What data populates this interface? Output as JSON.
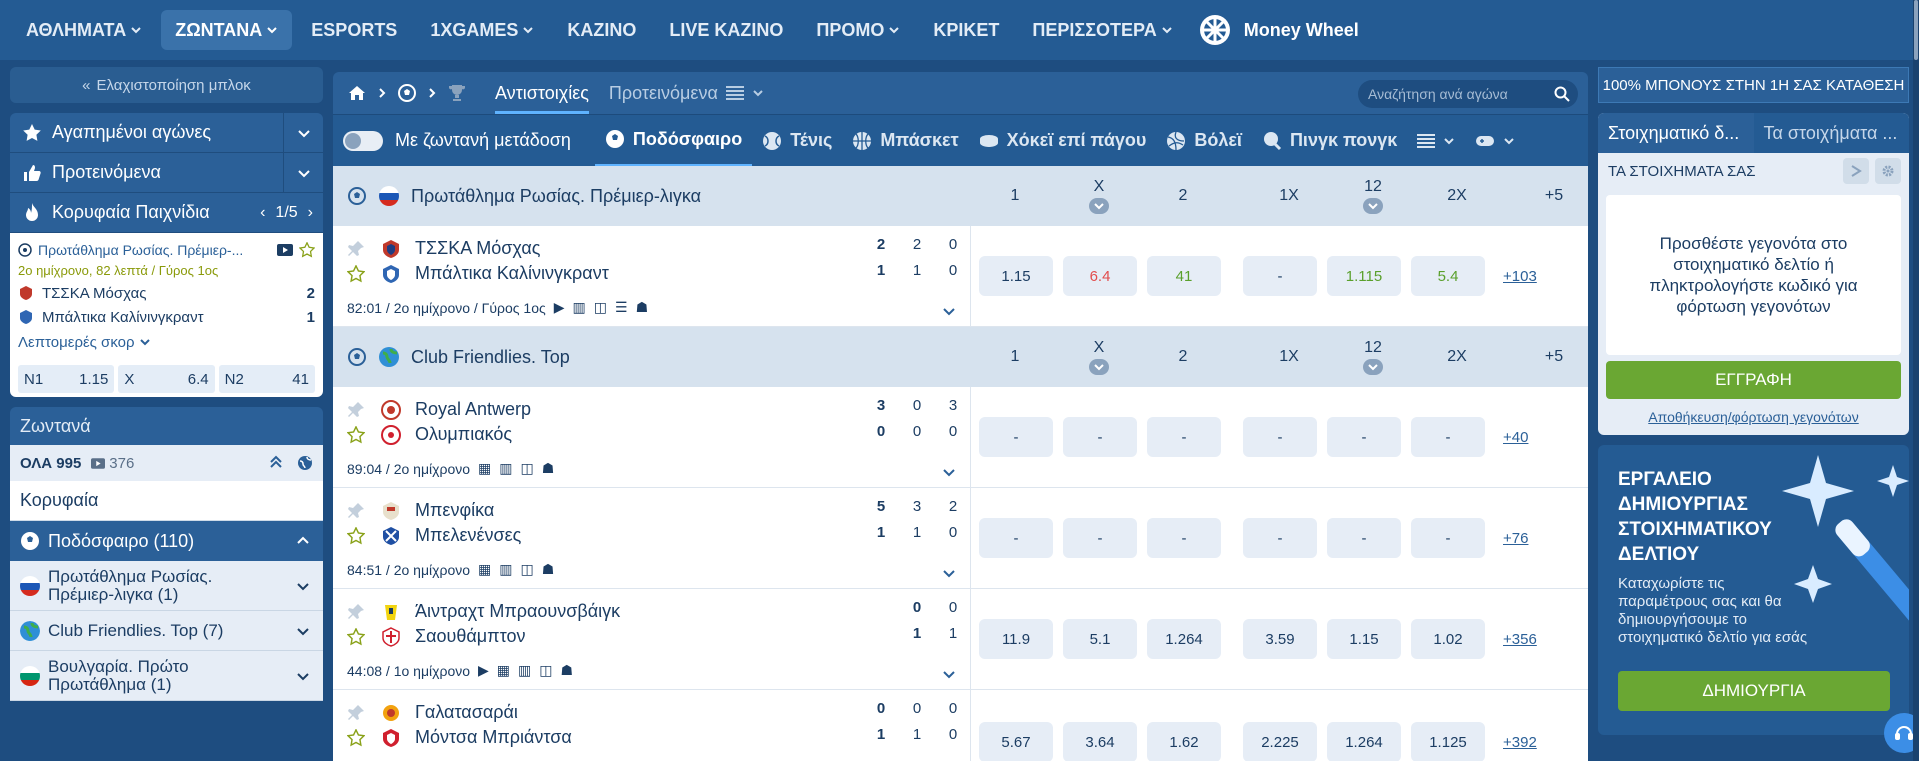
{
  "colors": {
    "nav_bg": "#245b93",
    "page_bg": "#1e4d80",
    "accent_green": "#6aa733",
    "odd_up": "#5aa02c",
    "odd_down": "#e24c4c",
    "link_blue": "#2b6098"
  },
  "nav": {
    "items": [
      {
        "label": "ΑΘΛΗΜΑΤΑ",
        "dropdown": true
      },
      {
        "label": "ΖΩΝΤΑΝΑ",
        "dropdown": true,
        "active": true
      },
      {
        "label": "ESPORTS"
      },
      {
        "label": "1XGAMES",
        "dropdown": true
      },
      {
        "label": "ΚΑΖΙΝΟ"
      },
      {
        "label": "LIVE ΚΑΖΙΝΟ"
      },
      {
        "label": "ΠΡΟΜΟ",
        "dropdown": true
      },
      {
        "label": "ΚΡΙΚΕΤ"
      },
      {
        "label": "ΠΕΡΙΣΣΟΤΕΡΑ",
        "dropdown": true
      }
    ],
    "money_wheel": "Money Wheel"
  },
  "sidebar": {
    "collapse": "Ελαχιστοποίηση μπλοκ",
    "favorites": "Αγαπημένοι αγώνες",
    "recommended": "Προτεινόμενα",
    "top_games": "Κορυφαία Παιχνίδια",
    "pager": "1/5",
    "top_game": {
      "league": "Πρωτάθλημα Ρωσίας. Πρέμιερ-...",
      "status": "2ο ημίχρονο, 82 λεπτά / Γύρος 1ος",
      "team1": "ΤΣΣΚΑ Μόσχας",
      "score1": "2",
      "team2": "Μπάλτικα Καλίνινγκραντ",
      "score2": "1",
      "details": "Λεπτομερές σκορ",
      "odds": [
        {
          "label": "N1",
          "value": "1.15"
        },
        {
          "label": "X",
          "value": "6.4"
        },
        {
          "label": "N2",
          "value": "41"
        }
      ]
    },
    "live": "Ζωντανά",
    "all_label": "ΟΛΑ 995",
    "video_count": "376",
    "top": "Κορυφαία",
    "football": "Ποδόσφαιρο (110)",
    "leagues": [
      {
        "name": "Πρωτάθλημα Ρωσίας. Πρέμιερ-λιγκα (1)"
      },
      {
        "name": "Club Friendlies. Top (7)"
      },
      {
        "name": "Βουλγαρία. Πρώτο Πρωτάθλημα (1)"
      }
    ]
  },
  "main": {
    "tab_active": "Αντιστοιχίες",
    "tab_other": "Προτεινόμενα",
    "search_placeholder": "Αναζήτηση ανά αγώνα",
    "live_toggle": "Με ζωντανή μετάδοση",
    "sports": [
      "Ποδόσφαιρο",
      "Τένις",
      "Μπάσκετ",
      "Χόκεϊ επί πάγου",
      "Βόλεϊ",
      "Πινγκ πονγκ"
    ],
    "columns": [
      "1",
      "X",
      "2",
      "1X",
      "12",
      "2X",
      "+5"
    ],
    "leagues": [
      {
        "name": "Πρωτάθλημα Ρωσίας. Πρέμιερ-λιγκα",
        "matches": [
          {
            "team1": "ΤΣΣΚΑ Μόσχας",
            "team2": "Μπάλτικα Καλίνινγκραντ",
            "s1": [
              "2",
              "2",
              "0"
            ],
            "s2": [
              "1",
              "1",
              "0"
            ],
            "time": "82:01 / 2ο ημίχρονο / Γύρος 1ος",
            "odds": [
              "1.15",
              "6.4",
              "41",
              "-",
              "1.115",
              "5.4"
            ],
            "more": "+103"
          }
        ]
      },
      {
        "name": "Club Friendlies. Top",
        "matches": [
          {
            "team1": "Royal Antwerp",
            "team2": "Ολυμπιακός",
            "s1": [
              "3",
              "0",
              "3"
            ],
            "s2": [
              "0",
              "0",
              "0"
            ],
            "time": "89:04 / 2ο ημίχρονο",
            "odds": [
              "-",
              "-",
              "-",
              "-",
              "-",
              "-"
            ],
            "more": "+40"
          },
          {
            "team1": "Μπενφίκα",
            "team2": "Μπελενένσες",
            "s1": [
              "5",
              "3",
              "2"
            ],
            "s2": [
              "1",
              "1",
              "0"
            ],
            "time": "84:51 / 2ο ημίχρονο",
            "odds": [
              "-",
              "-",
              "-",
              "-",
              "-",
              "-"
            ],
            "more": "+76"
          },
          {
            "team1": "Άιντραχτ Μπραουνσβάιγκ",
            "team2": "Σαουθάμπτον",
            "s1": [
              "0",
              "0"
            ],
            "s2": [
              "1",
              "1"
            ],
            "time": "44:08 / 1ο ημίχρονο",
            "odds": [
              "11.9",
              "5.1",
              "1.264",
              "3.59",
              "1.15",
              "1.02"
            ],
            "more": "+356"
          },
          {
            "team1": "Γαλατασαράι",
            "team2": "Μόντσα Μπριάντσα",
            "s1": [
              "0",
              "0",
              "0"
            ],
            "s2": [
              "1",
              "1",
              "0"
            ],
            "time": "",
            "odds": [
              "5.67",
              "3.64",
              "1.62",
              "2.225",
              "1.264",
              "1.125"
            ],
            "more": "+392"
          }
        ]
      }
    ]
  },
  "right": {
    "promo": "100% ΜΠΟΝΟΥΣ ΣΤΗΝ 1Η ΣΑΣ ΚΑΤΑΘΕΣΗ",
    "tab1": "Στοιχηματικό δ...",
    "tab2": "Τα στοιχήματα ...",
    "your_bets": "ΤΑ ΣΤΟΙΧΗΜΑΤΑ ΣΑΣ",
    "empty_text": "Προσθέστε γεγονότα στο στοιχηματικό δελτίο ή πληκτρολογήστε κωδικό για φόρτωση γεγονότων",
    "register": "ΕΓΓΡΑΦΗ",
    "save_load": "Αποθήκευση/φόρτωση γεγονότων",
    "tool_title": "ΕΡΓΑΛΕΙΟ ΔΗΜΙΟΥΡΓΙΑΣ ΣΤΟΙΧΗΜΑΤΙΚΟΥ ΔΕΛΤΙΟΥ",
    "tool_text": "Καταχωρίστε τις παραμέτρους σας και θα δημιουργήσουμε το στοιχηματικό δελτίο για εσάς",
    "create": "ΔΗΜΙΟΥΡΓΙΑ"
  }
}
